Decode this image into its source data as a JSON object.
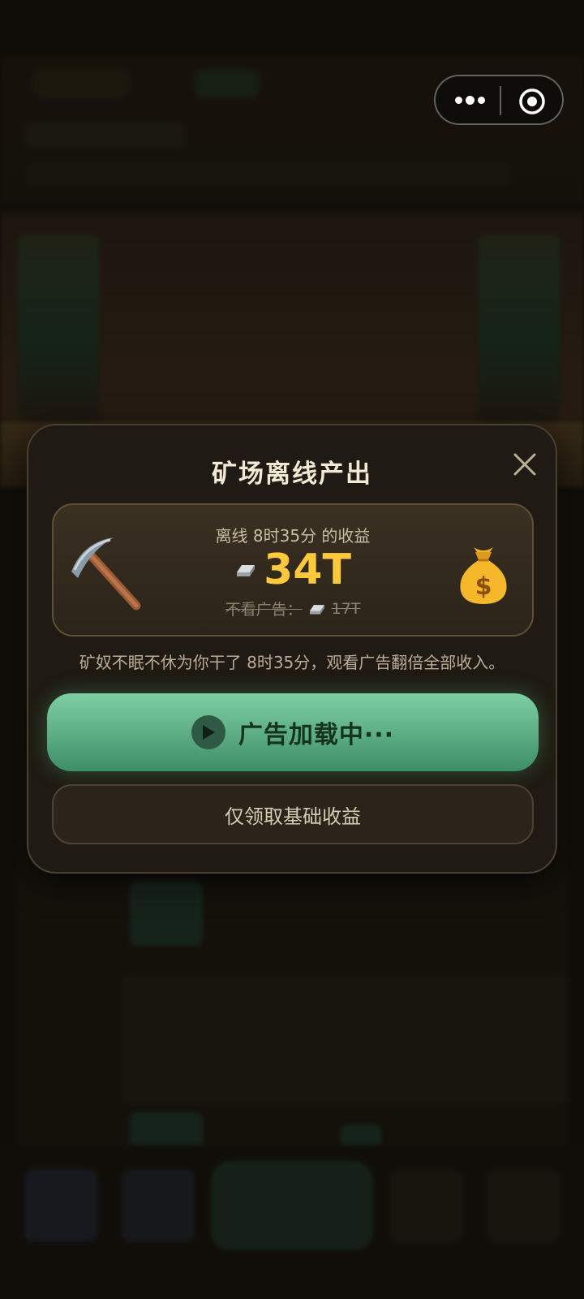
{
  "modal": {
    "title": "矿场离线产出",
    "reward": {
      "subtitle": "离线 8时35分 的收益",
      "amount": "34T",
      "no_ad_label": "不看广告：",
      "no_ad_amount": "17T"
    },
    "description": "矿奴不眠不休为你干了 8时35分，观看广告翻倍全部收入。",
    "ad_button_label": "广告加载中···",
    "base_button_label": "仅领取基础收益"
  },
  "colors": {
    "accent_gold": "#ffc93d",
    "ad_button": "#5aae84",
    "modal_bg": "#1f1a13"
  },
  "icons": {
    "reward_left": "pickaxe-icon",
    "reward_right": "money-bag-icon",
    "currency": "silver-ingot-icon",
    "button": "play-icon",
    "close": "close-icon"
  }
}
